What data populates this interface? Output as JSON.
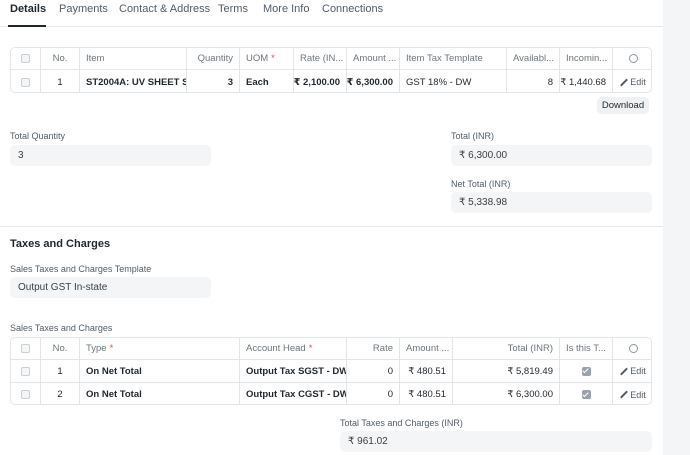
{
  "tabs": [
    "Details",
    "Payments",
    "Contact & Address",
    "Terms",
    "More Info",
    "Connections"
  ],
  "items_table": {
    "columns": [
      "No.",
      "Item",
      "Quantity",
      "UOM",
      "Rate (IN...",
      "Amount ...",
      "Item Tax Template",
      "Availabl...",
      "Incomin..."
    ],
    "rows": [
      {
        "no": "1",
        "item": "ST2004A: UV SHEET S...",
        "quantity": "3",
        "uom": "Each",
        "rate": "₹ 2,100.00",
        "amount": "₹ 6,300.00",
        "tax_template": "GST 18% - DW",
        "available": "8",
        "incoming": "₹ 1,440.68",
        "edit": "Edit"
      }
    ],
    "download_label": "Download"
  },
  "totals": {
    "total_quantity_label": "Total Quantity",
    "total_quantity": "3",
    "total_label": "Total (INR)",
    "total": "₹ 6,300.00",
    "net_total_label": "Net Total (INR)",
    "net_total": "₹ 5,338.98"
  },
  "taxes_section": {
    "title": "Taxes and Charges",
    "template_label": "Sales Taxes and Charges Template",
    "template_value": "Output GST In-state",
    "table_label": "Sales Taxes and Charges",
    "columns": [
      "No.",
      "Type",
      "Account Head",
      "Rate",
      "Amount ...",
      "Total (INR)",
      "Is this T..."
    ],
    "rows": [
      {
        "no": "1",
        "type": "On Net Total",
        "account_head": "Output Tax SGST - DW",
        "rate": "0",
        "amount": "₹ 480.51",
        "total": "₹ 5,819.49",
        "checked": true,
        "edit": "Edit"
      },
      {
        "no": "2",
        "type": "On Net Total",
        "account_head": "Output Tax CGST - DW",
        "rate": "0",
        "amount": "₹ 480.51",
        "total": "₹ 6,300.00",
        "checked": true,
        "edit": "Edit"
      }
    ],
    "total_taxes_label": "Total Taxes and Charges (INR)",
    "total_taxes": "₹ 961.02"
  }
}
